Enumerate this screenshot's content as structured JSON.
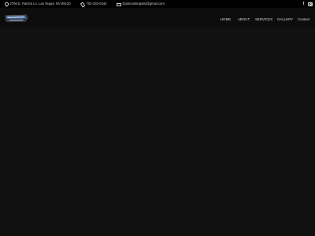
{
  "topbar": {
    "address": "2706 E. Patrick Ln. Las Vegas, NV 89120",
    "phone": "702-333-0444",
    "email": "Diamondsrapslv@gmail.com",
    "social": {
      "facebook": "f"
    }
  },
  "nav": {
    "items": [
      "HOME",
      "ABOUT",
      "SERVICES",
      "GALLERY",
      "Contact"
    ]
  },
  "colors": {
    "topbar_bg": "#000000",
    "page_bg": "#0d0d0d",
    "hero_bg": "#111111",
    "logo_accent": "#3a6fb0"
  }
}
